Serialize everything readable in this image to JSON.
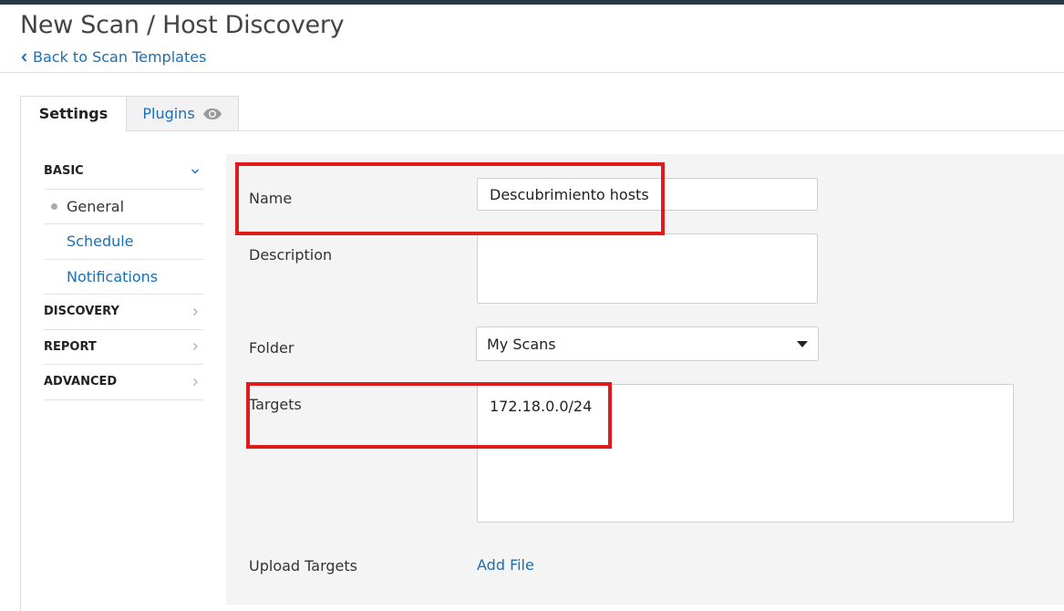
{
  "header": {
    "title": "New Scan / Host Discovery",
    "back_link": "Back to Scan Templates"
  },
  "tabs": [
    {
      "label": "Settings",
      "active": true
    },
    {
      "label": "Plugins",
      "icon": "eye-icon"
    }
  ],
  "sidebar": {
    "sections": [
      {
        "label": "BASIC",
        "expanded": true,
        "icon": "chevron-down-icon",
        "items": [
          {
            "label": "General",
            "active": true
          },
          {
            "label": "Schedule"
          },
          {
            "label": "Notifications"
          }
        ]
      },
      {
        "label": "DISCOVERY",
        "icon": "chevron-right-icon"
      },
      {
        "label": "REPORT",
        "icon": "chevron-right-icon"
      },
      {
        "label": "ADVANCED",
        "icon": "chevron-right-icon"
      }
    ]
  },
  "form": {
    "name_label": "Name",
    "name_value": "Descubrimiento hosts",
    "description_label": "Description",
    "description_value": "",
    "folder_label": "Folder",
    "folder_value": "My Scans",
    "targets_label": "Targets",
    "targets_value": "172.18.0.0/24",
    "upload_label": "Upload Targets",
    "upload_link": "Add File"
  },
  "colors": {
    "accent": "#1a6fb5",
    "highlight": "#e01b1b",
    "top_bar": "#263746",
    "panel_bg": "#f4f4f4"
  }
}
